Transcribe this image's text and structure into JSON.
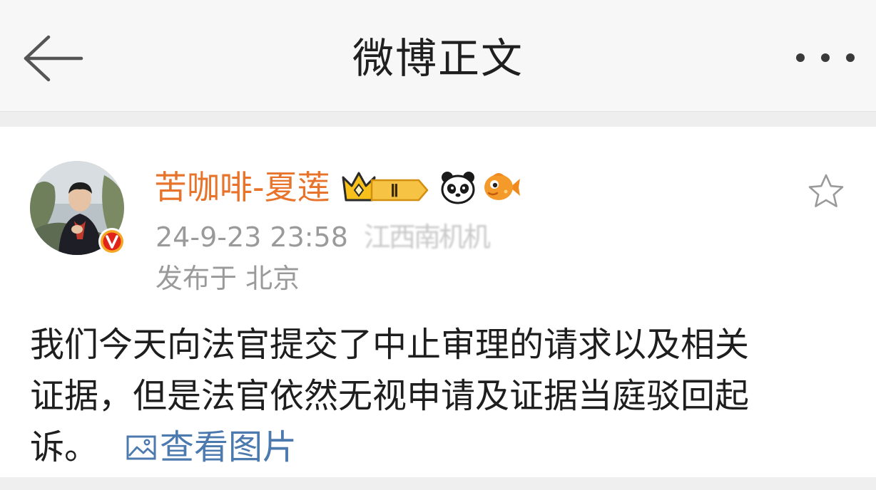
{
  "header": {
    "title": "微博正文",
    "back_icon": "arrow-left-icon",
    "more_icon": "more-dots-icon"
  },
  "post": {
    "user": {
      "name": "苦咖啡-夏莲",
      "verified_badge": "V",
      "level_badge": "Ⅱ",
      "accent_color": "#e8732b"
    },
    "time": "24-9-23 23:58",
    "source": "江西南机机",
    "location": "发布于 北京",
    "content_lines": [
      "我们今天向法官提交了中止审理的请求以及相关",
      "证据，但是法官依然无视申请及证据当庭驳回起",
      "诉。"
    ],
    "view_image_label": "查看图片",
    "link_color": "#4d7aae"
  }
}
